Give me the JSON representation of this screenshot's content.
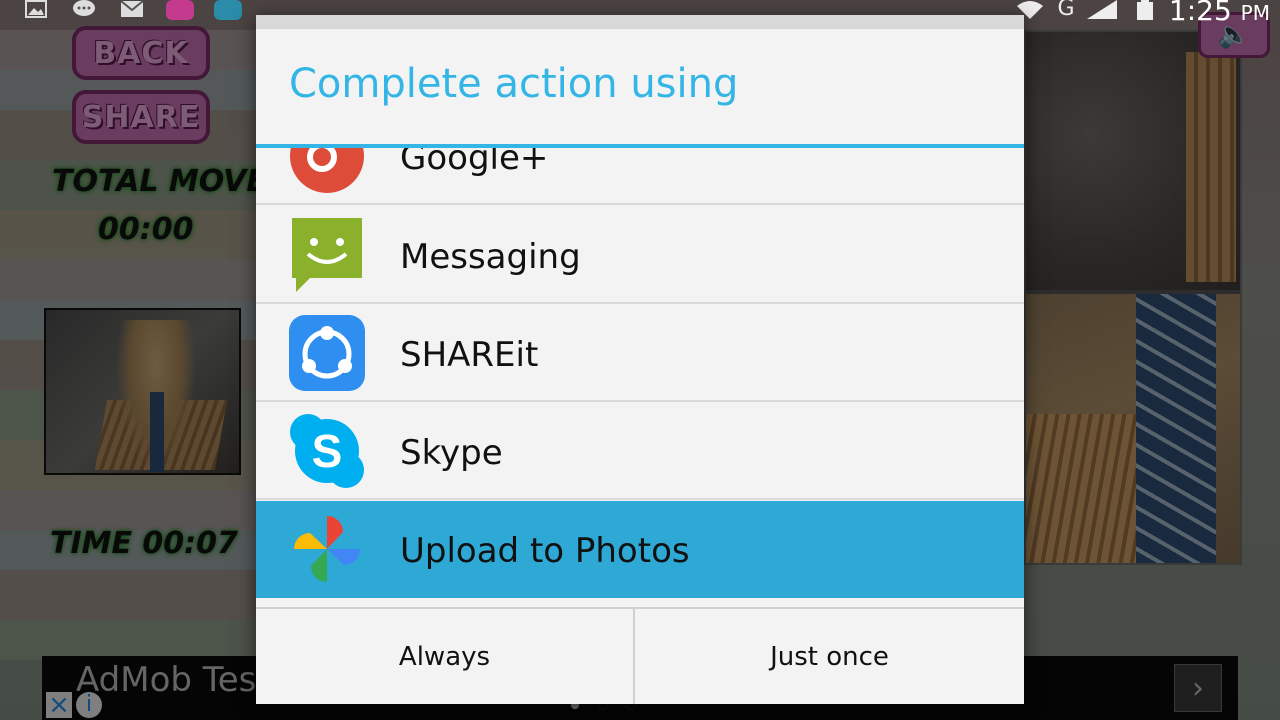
{
  "status_bar": {
    "time": "1:25",
    "ampm": "PM",
    "network": "G"
  },
  "game": {
    "back_label": "BACK",
    "share_label": "SHARE",
    "total_move_label": "TOTAL MOVE",
    "total_move_value": "00:00",
    "time_label": "TIME 00:07"
  },
  "ad": {
    "text": "AdMob Tes"
  },
  "dialog": {
    "title": "Complete action using",
    "apps": [
      {
        "label": "Google+",
        "icon": "google-plus-icon"
      },
      {
        "label": "Messaging",
        "icon": "messaging-icon"
      },
      {
        "label": "SHAREit",
        "icon": "shareit-icon"
      },
      {
        "label": "Skype",
        "icon": "skype-icon"
      },
      {
        "label": "Upload to Photos",
        "icon": "google-photos-icon",
        "selected": true
      },
      {
        "label": "",
        "icon": "partial-app-icon"
      }
    ],
    "buttons": {
      "always": "Always",
      "just_once": "Just once"
    },
    "accent_color": "#33b5e5",
    "selected_color": "#2ea8d5"
  }
}
